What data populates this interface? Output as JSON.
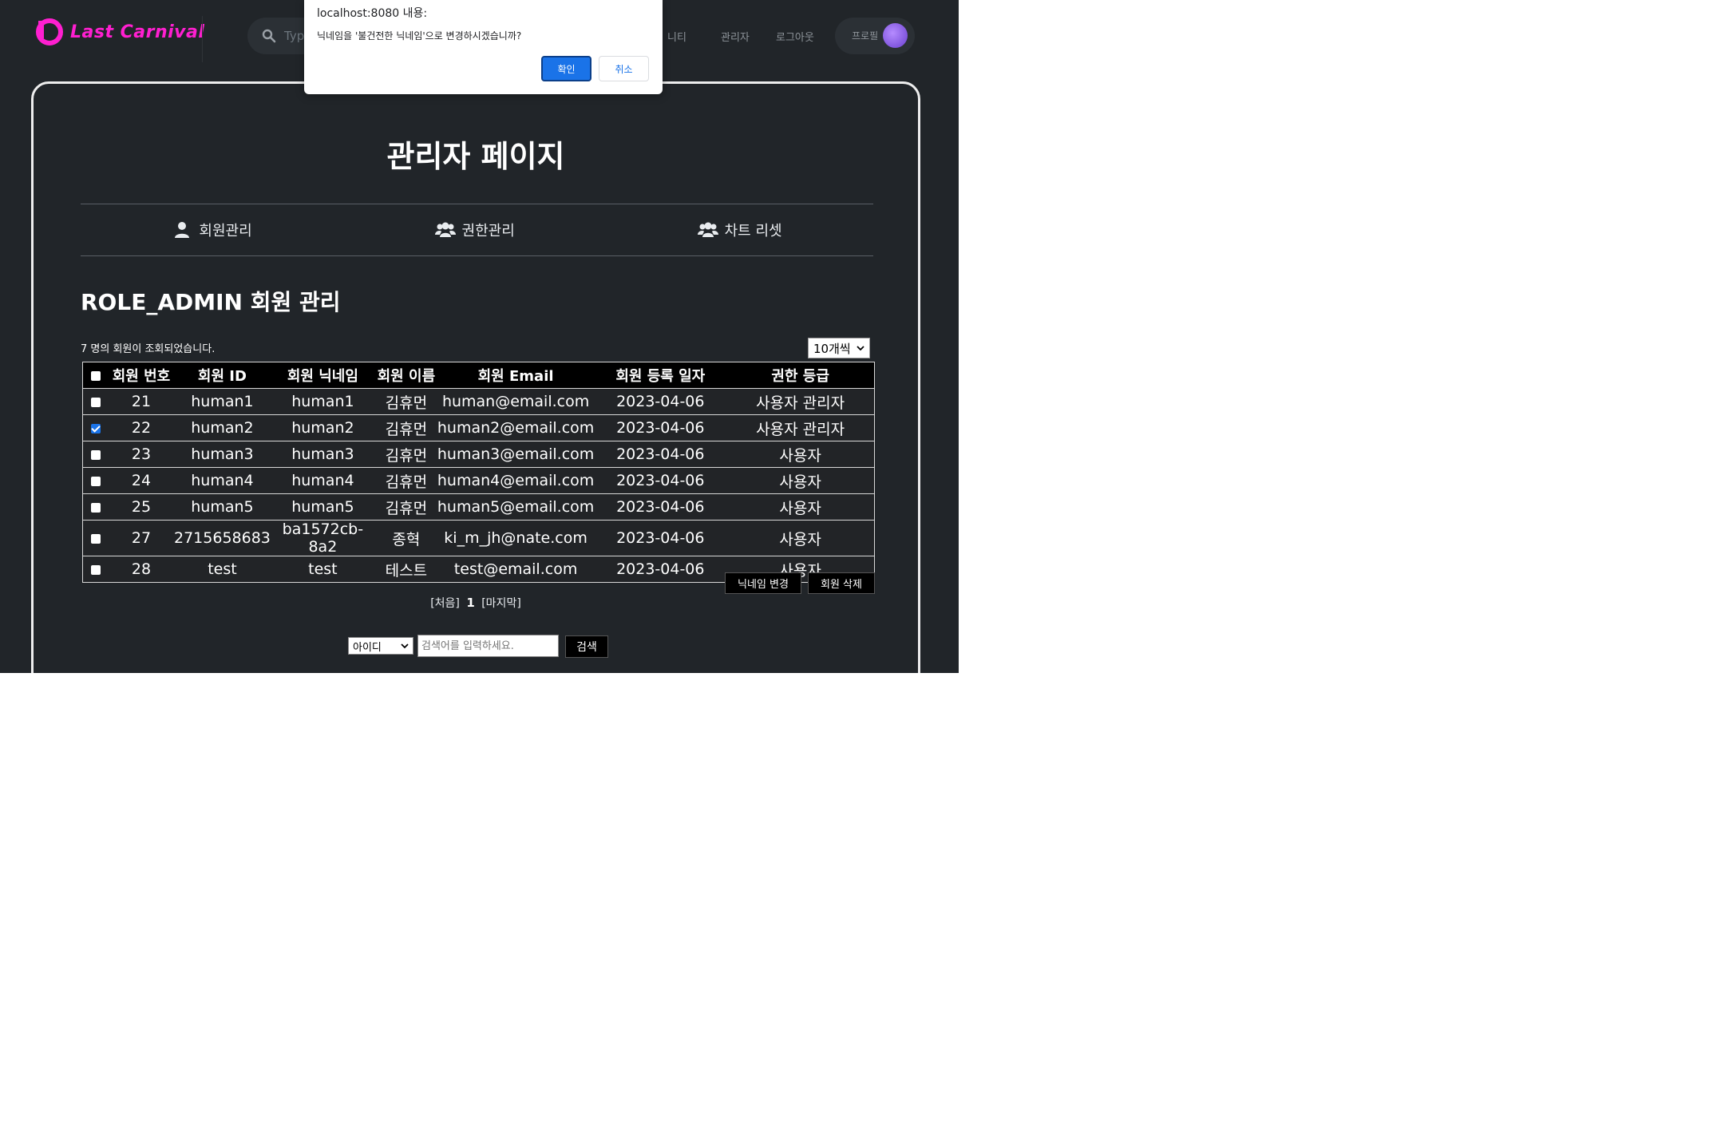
{
  "nav": {
    "logo_text": "Last Carnival",
    "search_placeholder": "Type",
    "links": [
      "니티",
      "관리자",
      "로그아웃"
    ],
    "profile_label": "프로필",
    "brand_color": "#ff1fd0"
  },
  "page": {
    "title": "관리자 페이지",
    "tabs": [
      "회원관리",
      "권한관리",
      "차트 리셋"
    ],
    "section_title": "ROLE_ADMIN 회원 관리",
    "count_text": "7 명의 회원이 조회되었습니다.",
    "page_size": "10개씩"
  },
  "table": {
    "headers": [
      "회원 번호",
      "회원 ID",
      "회원 닉네임",
      "회원 이름",
      "회원 Email",
      "회원 등록 일자",
      "권한 등급"
    ],
    "rows": [
      {
        "checked": false,
        "no": "21",
        "id": "human1",
        "nickname": "human1",
        "name": "김휴먼",
        "email": "human@email.com",
        "date": "2023-04-06",
        "role": "사용자 관리자"
      },
      {
        "checked": true,
        "no": "22",
        "id": "human2",
        "nickname": "human2",
        "name": "김휴먼",
        "email": "human2@email.com",
        "date": "2023-04-06",
        "role": "사용자 관리자"
      },
      {
        "checked": false,
        "no": "23",
        "id": "human3",
        "nickname": "human3",
        "name": "김휴먼",
        "email": "human3@email.com",
        "date": "2023-04-06",
        "role": "사용자"
      },
      {
        "checked": false,
        "no": "24",
        "id": "human4",
        "nickname": "human4",
        "name": "김휴먼",
        "email": "human4@email.com",
        "date": "2023-04-06",
        "role": "사용자"
      },
      {
        "checked": false,
        "no": "25",
        "id": "human5",
        "nickname": "human5",
        "name": "김휴먼",
        "email": "human5@email.com",
        "date": "2023-04-06",
        "role": "사용자"
      },
      {
        "checked": false,
        "no": "27",
        "id": "2715658683",
        "nickname": "ba1572cb-8a2",
        "name": "종혁",
        "email": "ki_m_jh@nate.com",
        "date": "2023-04-06",
        "role": "사용자"
      },
      {
        "checked": false,
        "no": "28",
        "id": "test",
        "nickname": "test",
        "name": "테스트",
        "email": "test@email.com",
        "date": "2023-04-06",
        "role": "사용자"
      }
    ]
  },
  "actions": {
    "change_nickname": "닉네임 변경",
    "delete_member": "회원 삭제"
  },
  "pager": {
    "first": "[처음]",
    "current": "1",
    "last": "[마지막]"
  },
  "search": {
    "type": "아이디",
    "placeholder": "검색어를 입력하세요.",
    "button": "검색"
  },
  "dialog": {
    "title": "localhost:8080 내용:",
    "message": "닉네임을 '불건전한 닉네임'으로 변경하시겠습니까?",
    "ok": "확인",
    "cancel": "취소"
  }
}
